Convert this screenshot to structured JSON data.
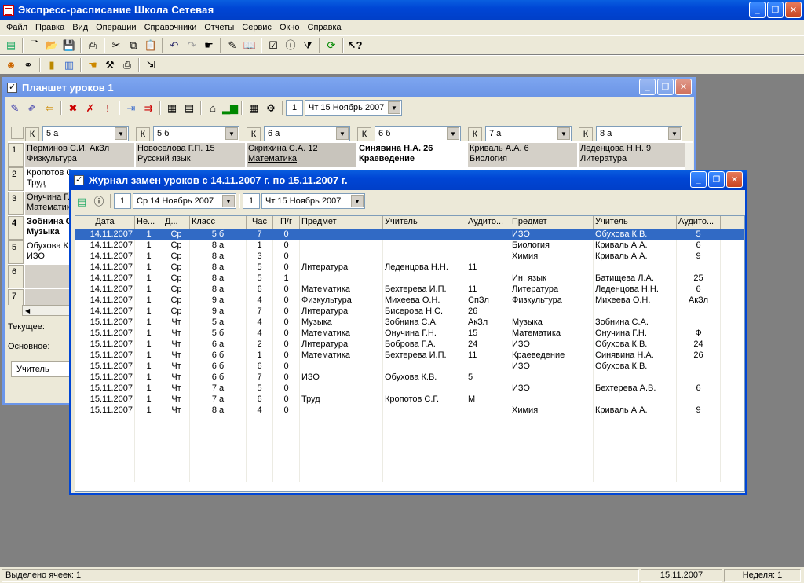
{
  "app": {
    "title": "Экспресс-расписание Школа Сетевая",
    "win_min": "_",
    "win_max": "❐",
    "win_close": "✕"
  },
  "menu": [
    "Файл",
    "Правка",
    "Вид",
    "Операции",
    "Справочники",
    "Отчеты",
    "Сервис",
    "Окно",
    "Справка"
  ],
  "toolbar1_icons": [
    "list-icon",
    "new-icon",
    "open-icon",
    "save-icon",
    "print-icon",
    "cut-icon",
    "copy-icon",
    "paste-icon",
    "undo-icon",
    "redo-icon",
    "pointer-icon",
    "edit-icon",
    "book-icon",
    "check-icon",
    "info-icon",
    "filter-icon",
    "refresh-icon",
    "help-pointer-icon"
  ],
  "toolbar2_icons": [
    "teacher-icon",
    "class-icon",
    "door-icon",
    "chart-icon",
    "hand-icon",
    "tools-icon",
    "printer-icon",
    "exit-icon"
  ],
  "planshet": {
    "title": "Планшет уроков 1",
    "day_num": "1",
    "date": "Чт 15  Ноябрь  2007",
    "k_label": "К",
    "classes": [
      "5 а",
      "5 б",
      "6 а",
      "6 б",
      "7 а",
      "8 а"
    ],
    "row_nums": [
      "1",
      "2",
      "3",
      "4",
      "5",
      "6",
      "7"
    ],
    "row1": [
      {
        "line1": "Перминов С.И.  АкЗл",
        "line2": "Физкультура"
      },
      {
        "line1": "Новоселова Г.П.  15",
        "line2": "Русский язык"
      },
      {
        "line1": "Скрихина С.А.   12",
        "line2": "Математика"
      },
      {
        "line1": "Синявина Н.А.   26",
        "line2": "Краеведение"
      },
      {
        "line1": "Криваль А.А.    6",
        "line2": "Биология"
      },
      {
        "line1": "Леденцова Н.Н.   9",
        "line2": "Литература"
      }
    ],
    "col1_rest": [
      {
        "line1": "Кропотов С",
        "line2": "Труд"
      },
      {
        "line1": "Онучина Г.Н",
        "line2": "Математик"
      },
      {
        "line1": "Зобнина С",
        "line2": "Музыка"
      },
      {
        "line1": "Обухова К.В",
        "line2": "ИЗО"
      }
    ],
    "current_label": "Текущее:",
    "main_label": "Основное:",
    "teacher_tab": "Учитель"
  },
  "journal": {
    "title": "Журнал замен уроков с 14.11.2007 г. по 15.11.2007 г.",
    "from_num": "1",
    "from_date": "Ср 14  Ноябрь  2007",
    "to_num": "1",
    "to_date": "Чт 15  Ноябрь  2007",
    "headers": [
      "Дата",
      "Не...",
      "Д...",
      "Класс",
      "Час",
      "П/г",
      "Предмет",
      "Учитель",
      "Аудито...",
      "Предмет",
      "Учитель",
      "Аудито..."
    ],
    "rows": [
      [
        "14.11.2007",
        "1",
        "Ср",
        "5 б",
        "7",
        "0",
        "",
        "",
        "",
        "ИЗО",
        "Обухова К.В.",
        "5"
      ],
      [
        "14.11.2007",
        "1",
        "Ср",
        "8 а",
        "1",
        "0",
        "",
        "",
        "",
        "Биология",
        "Криваль А.А.",
        "6"
      ],
      [
        "14.11.2007",
        "1",
        "Ср",
        "8 а",
        "3",
        "0",
        "",
        "",
        "",
        "Химия",
        "Криваль А.А.",
        "9"
      ],
      [
        "14.11.2007",
        "1",
        "Ср",
        "8 а",
        "5",
        "0",
        "Литература",
        "Леденцова Н.Н.",
        "11",
        "",
        "",
        ""
      ],
      [
        "14.11.2007",
        "1",
        "Ср",
        "8 а",
        "5",
        "1",
        "",
        "",
        "",
        "Ин. язык",
        "Батищева Л.А.",
        "25"
      ],
      [
        "14.11.2007",
        "1",
        "Ср",
        "8 а",
        "6",
        "0",
        "Математика",
        "Бехтерева И.П.",
        "11",
        "Литература",
        "Леденцова Н.Н.",
        "6"
      ],
      [
        "14.11.2007",
        "1",
        "Ср",
        "9 а",
        "4",
        "0",
        "Физкультура",
        "Михеева О.Н.",
        "СпЗл",
        "Физкультура",
        "Михеева О.Н.",
        "АкЗл"
      ],
      [
        "14.11.2007",
        "1",
        "Ср",
        "9 а",
        "7",
        "0",
        "Литература",
        "Бисерова Н.С.",
        "26",
        "",
        "",
        ""
      ],
      [
        "15.11.2007",
        "1",
        "Чт",
        "5 а",
        "4",
        "0",
        "Музыка",
        "Зобнина С.А.",
        "АкЗл",
        "Музыка",
        "Зобнина С.А.",
        ""
      ],
      [
        "15.11.2007",
        "1",
        "Чт",
        "5 б",
        "4",
        "0",
        "Математика",
        "Онучина Г.Н.",
        "15",
        "Математика",
        "Онучина Г.Н.",
        "Ф"
      ],
      [
        "15.11.2007",
        "1",
        "Чт",
        "6 а",
        "2",
        "0",
        "Литература",
        "Боброва Г.А.",
        "24",
        "ИЗО",
        "Обухова К.В.",
        "24"
      ],
      [
        "15.11.2007",
        "1",
        "Чт",
        "6 б",
        "1",
        "0",
        "Математика",
        "Бехтерева И.П.",
        "11",
        "Краеведение",
        "Синявина Н.А.",
        "26"
      ],
      [
        "15.11.2007",
        "1",
        "Чт",
        "6 б",
        "6",
        "0",
        "",
        "",
        "",
        "ИЗО",
        "Обухова К.В.",
        ""
      ],
      [
        "15.11.2007",
        "1",
        "Чт",
        "6 б",
        "7",
        "0",
        "ИЗО",
        "Обухова К.В.",
        "5",
        "",
        "",
        ""
      ],
      [
        "15.11.2007",
        "1",
        "Чт",
        "7 а",
        "5",
        "0",
        "",
        "",
        "",
        "ИЗО",
        "Бехтерева А.В.",
        "6"
      ],
      [
        "15.11.2007",
        "1",
        "Чт",
        "7 а",
        "6",
        "0",
        "Труд",
        "Кропотов С.Г.",
        "М",
        "",
        "",
        ""
      ],
      [
        "15.11.2007",
        "1",
        "Чт",
        "8 а",
        "4",
        "0",
        "",
        "",
        "",
        "Химия",
        "Криваль А.А.",
        "9"
      ]
    ]
  },
  "status": {
    "selected": "Выделено ячеек: 1",
    "date": "15.11.2007",
    "week": "Неделя: 1"
  }
}
